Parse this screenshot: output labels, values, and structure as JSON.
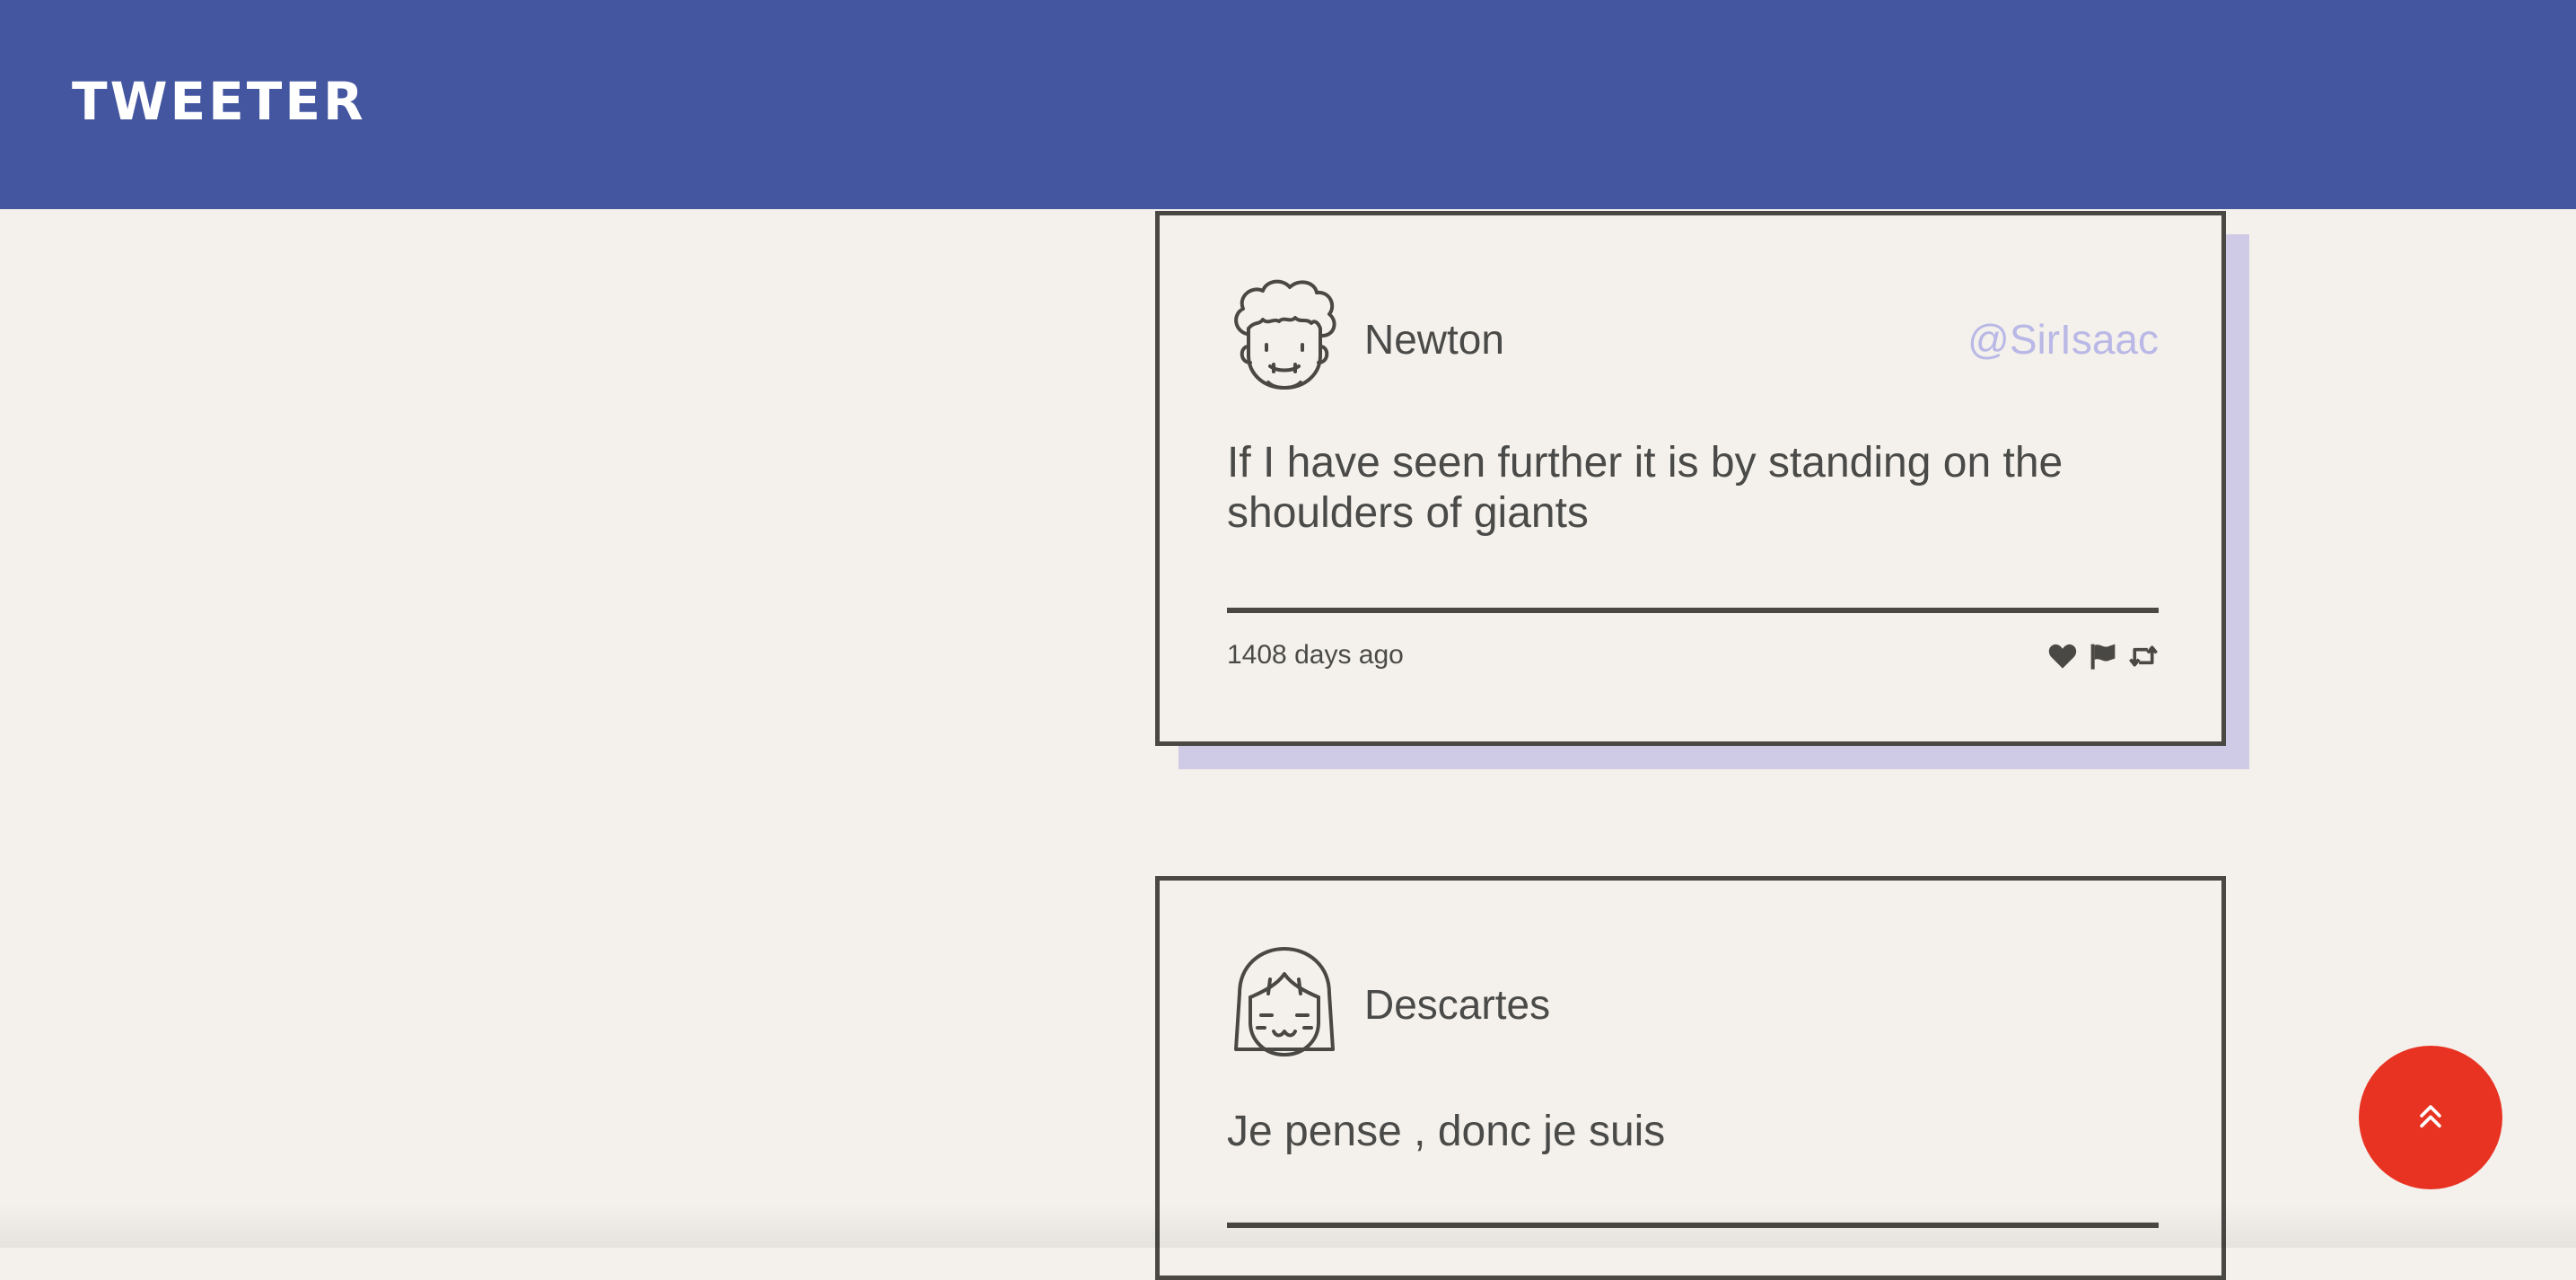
{
  "header": {
    "brand": "TWEETER"
  },
  "tweets": [
    {
      "author_name": "Newton",
      "handle": "@SirIsaac",
      "content": "If I have seen further it is by standing on the shoulders of giants",
      "timestamp": "1408 days ago",
      "avatar_icon": "curly-hair-face-icon",
      "actions": [
        "heart-icon",
        "flag-icon",
        "retweet-icon"
      ]
    },
    {
      "author_name": "Descartes",
      "handle": "",
      "content": "Je pense , donc je suis",
      "avatar_icon": "bob-hair-face-icon"
    }
  ],
  "scroll_top": {
    "icon": "double-chevron-up-icon"
  },
  "colors": {
    "header_bg": "#4456a0",
    "page_bg": "#f4f1ec",
    "handle": "#b9b8e6",
    "card_shadow": "#cfcbe6",
    "scroll_button": "#e83323",
    "ink": "#4a4a48"
  }
}
